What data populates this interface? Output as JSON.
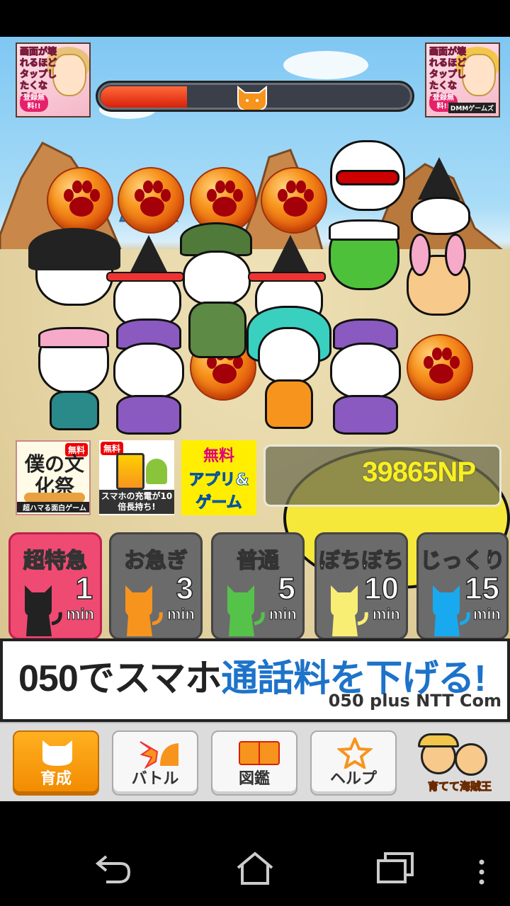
{
  "top_ads": {
    "left": {
      "text": "画面が壊れるほどタップしたくなる!",
      "badge": "登録無料!!"
    },
    "right": {
      "text": "画面が壊れるほどタップしたくなる!",
      "badge": "登録無料!!",
      "brand": "DMMゲームズ"
    }
  },
  "progress": {
    "fraction": 0.28
  },
  "apps": [
    {
      "title": "僕の文化祭",
      "tag": "無料",
      "caption": "超ハマる面白ゲーム"
    },
    {
      "tag": "無料",
      "caption": "スマホの充電が10倍長持ち!"
    },
    {
      "line1": "無料",
      "line2": "アプリ&",
      "line3": "ゲーム"
    }
  ],
  "np_display": "39865NP",
  "speeds": [
    {
      "label": "超特急",
      "num": "1",
      "unit": "min",
      "color": "#ef4a72",
      "cat": "#222222"
    },
    {
      "label": "お急ぎ",
      "num": "3",
      "unit": "min",
      "color": "#6b6b6b",
      "cat": "#f7941d"
    },
    {
      "label": "普通",
      "num": "5",
      "unit": "min",
      "color": "#6b6b6b",
      "cat": "#55c24a"
    },
    {
      "label": "ぼちぼち",
      "num": "10",
      "unit": "min",
      "color": "#6b6b6b",
      "cat": "#f8ee74"
    },
    {
      "label": "じっくり",
      "num": "15",
      "unit": "min",
      "color": "#6b6b6b",
      "cat": "#19a9ee"
    }
  ],
  "banner": {
    "part1": "050でスマホ",
    "part2": "通話料を下げる!",
    "sub": "050 plus NTT Com"
  },
  "nav": [
    {
      "label": "育成",
      "icon": "cat-icon"
    },
    {
      "label": "バトル",
      "icon": "battle-icon"
    },
    {
      "label": "図鑑",
      "icon": "book-icon"
    },
    {
      "label": "ヘルプ",
      "icon": "star-icon"
    }
  ],
  "promo": {
    "text": "育てて海賊王"
  },
  "colors": {
    "accent": "#f28a00",
    "np": "#f8f020",
    "fast": "#ef4a72"
  }
}
